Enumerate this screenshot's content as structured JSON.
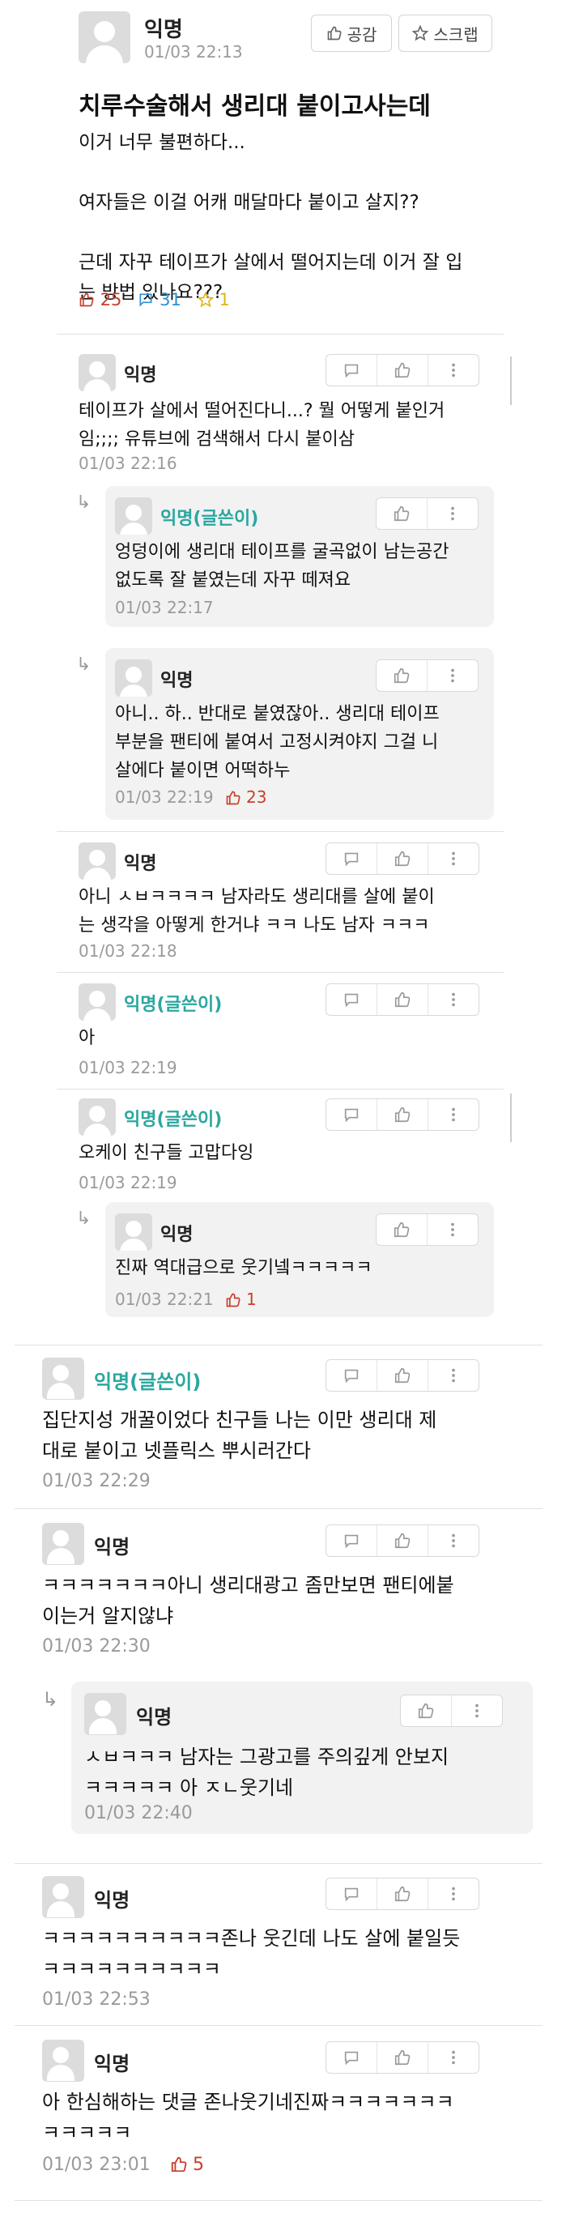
{
  "post": {
    "author": "익명",
    "time": "01/03 22:13",
    "like_btn": "공감",
    "scrap_btn": "스크랩",
    "title": "치루수술해서 생리대 붙이고사는데",
    "body": "이거 너무 불편하다...\n\n여자들은 이걸 어캐 매달마다 붙이고 살지??\n\n근데 자꾸 테이프가 살에서 떨어지는데 이거 잘 입\n는 방법 있나요???",
    "likes": "25",
    "comments": "31",
    "scraps": "1"
  },
  "comments": [
    {
      "author": "익명",
      "text": "테이프가 살에서 떨어진다니...? 뭘 어떻게 붙인거\n임;;;; 유튜브에 검색해서 다시 붙이삼",
      "time": "01/03 22:16"
    },
    {
      "author": "익명(글쓴이)",
      "text": "엉덩이에 생리대 테이프를 굴곡없이 남는공간\n없도록 잘 붙였는데 자꾸 떼져요",
      "time": "01/03 22:17"
    },
    {
      "author": "익명",
      "text": "아니.. 하.. 반대로 붙였잖아.. 생리대 테이프\n부분을 팬티에 붙여서 고정시켜야지 그걸 니\n살에다 붙이면 어떡하누",
      "time": "01/03 22:19",
      "likes": "23"
    },
    {
      "author": "익명",
      "text": "아니 ㅅㅂㅋㅋㅋㅋ 남자라도 생리대를 살에 붙이\n는 생각을 아떻게 한거냐 ㅋㅋ 나도 남자 ㅋㅋㅋ",
      "time": "01/03 22:18"
    },
    {
      "author": "익명(글쓴이)",
      "text": "아",
      "time": "01/03 22:19"
    },
    {
      "author": "익명(글쓴이)",
      "text": "오케이 친구들 고맙다잉",
      "time": "01/03 22:19"
    },
    {
      "author": "익명",
      "text": "진짜 역대급으로 웃기넼ㅋㅋㅋㅋㅋ",
      "time": "01/03 22:21",
      "likes": "1"
    },
    {
      "author": "익명(글쓴이)",
      "text": "집단지성 개꿀이었다 친구들 나는 이만 생리대 제\n대로 붙이고 넷플릭스 뿌시러간다",
      "time": "01/03 22:29"
    },
    {
      "author": "익명",
      "text": "ㅋㅋㅋㅋㅋㅋㅋ아니 생리대광고 좀만보면 팬티에붙\n이는거 알지않냐",
      "time": "01/03 22:30"
    },
    {
      "author": "익명",
      "text": "ㅅㅂㅋㅋㅋ 남자는 그광고를 주의깊게 안보지\nㅋㅋㅋㅋㅋ 아 ㅈㄴ웃기네",
      "time": "01/03 22:40"
    },
    {
      "author": "익명",
      "text": "ㅋㅋㅋㅋㅋㅋㅋㅋㅋㅋ존나 웃긴데 나도 살에 붙일듯\nㅋㅋㅋㅋㅋㅋㅋㅋㅋㅋ",
      "time": "01/03 22:53"
    },
    {
      "author": "익명",
      "text": "아 한심해하는 댓글 존나웃기네진짜ㅋㅋㅋㅋㅋㅋㅋ\nㅋㅋㅋㅋㅋ",
      "time": "01/03 23:01",
      "likes": "5"
    }
  ],
  "icons": {
    "reply": "speech-bubble-icon",
    "like": "thumbs-up-icon",
    "more": "kebab-icon",
    "comment_count": "comment-icon",
    "scrap": "star-icon",
    "reply_arrow": "reply-arrow-icon"
  },
  "colors": {
    "op_name": "#2aa7a0",
    "like_red": "#c6402c",
    "comment_blue": "#2b8fd6",
    "scrap_yellow": "#e2b416"
  }
}
